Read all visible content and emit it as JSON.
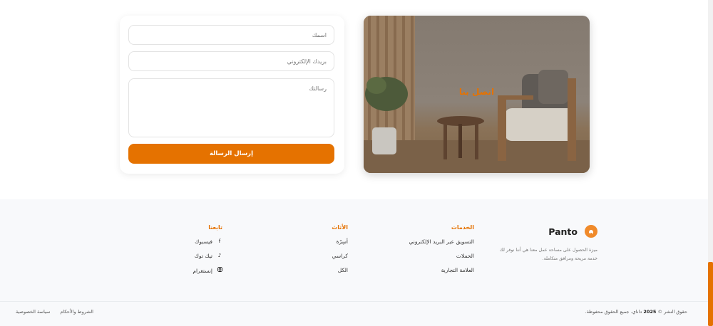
{
  "contact_form": {
    "name_placeholder": "اسمك",
    "email_placeholder": "بريدك الإلكتروني",
    "message_placeholder": "رسالتك",
    "submit_label": "إرسال الرسالة"
  },
  "contact_image": {
    "title": "اتصل بنا"
  },
  "footer": {
    "brand": {
      "name": "Panto",
      "description": "ميزة الحصول على مساحة عمل معنا هي أننا نوفر لك خدمة مريحة ومرافق متكاملة."
    },
    "services": {
      "title": "الخدمات",
      "items": [
        "التسويق عبر البريد الإلكتروني",
        "الحملات",
        "العلامة التجارية"
      ]
    },
    "furniture": {
      "title": "الأثاث",
      "items": [
        "أسِرّة",
        "كراسي",
        "الكل"
      ]
    },
    "follow": {
      "title": "تابعنا",
      "items": [
        {
          "label": "فيسبوك",
          "icon": "facebook-icon"
        },
        {
          "label": "تيك توك",
          "icon": "tiktok-icon"
        },
        {
          "label": "إنستغرام",
          "icon": "instagram-icon"
        }
      ]
    },
    "copyright": {
      "prefix": "حقوق النشر ©",
      "year": "2025",
      "suffix": "داناي. جميع الحقوق محفوظة."
    },
    "links": {
      "terms": "الشروط والأحكام",
      "privacy": "سياسة الخصوصية"
    }
  },
  "colors": {
    "accent": "#e57200",
    "footer_bg": "#f8f9fb"
  }
}
